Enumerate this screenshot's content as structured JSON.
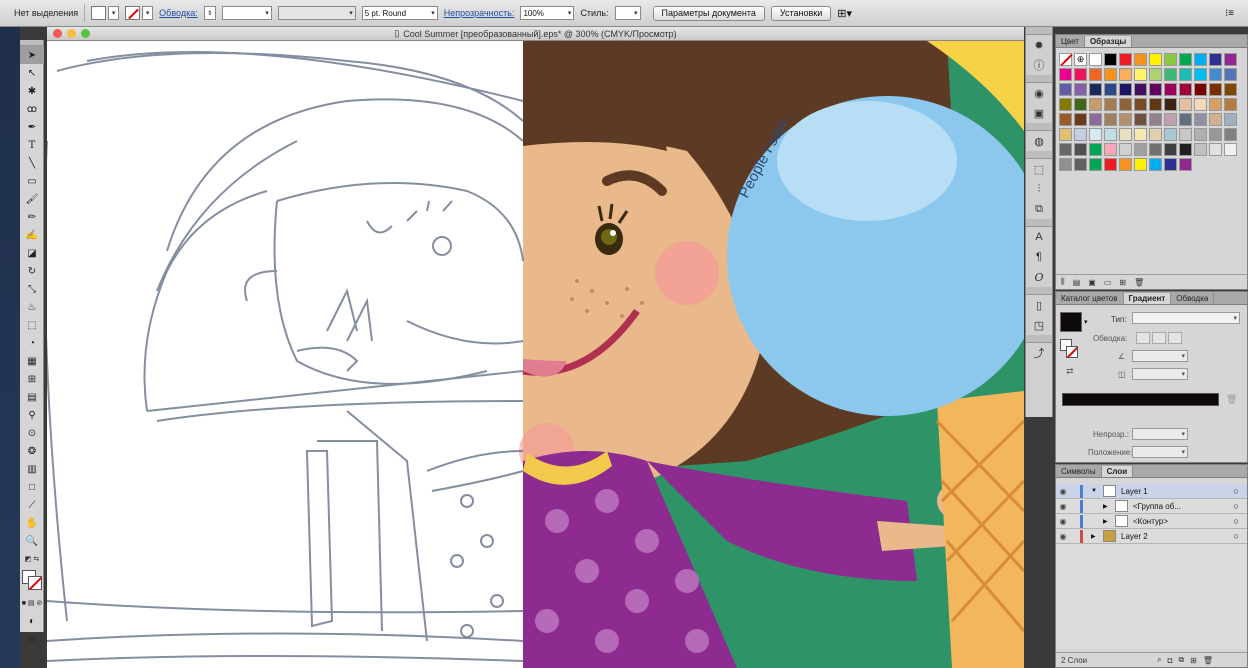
{
  "control_bar": {
    "selection": "Нет выделения",
    "stroke_label": "Обводка:",
    "brush": "5 pt. Round",
    "opacity_label": "Непрозрачность:",
    "opacity_value": "100%",
    "style_label": "Стиль:",
    "doc_settings": "Параметры документа",
    "preferences": "Установки"
  },
  "document": {
    "title": "Cool Summer [преобразованный].eps* @ 300% (CMYK/Просмотр)",
    "balloon_text": "People I saw..."
  },
  "swatches_panel": {
    "tabs": [
      "Цвет",
      "Образцы"
    ],
    "active_tab": "Образцы",
    "colors": [
      "#ffffff",
      "#000000",
      "#ed1c24",
      "#f7941d",
      "#fff200",
      "#8dc63f",
      "#00a651",
      "#00aeef",
      "#2e3192",
      "#92278f",
      "#ec008c",
      "#ed145b",
      "#f26522",
      "#f7941d",
      "#fbaf5d",
      "#fff568",
      "#acd373",
      "#3cb878",
      "#1cbbb4",
      "#00bff3",
      "#448ccb",
      "#5674b9",
      "#605ca8",
      "#855fa8",
      "#1a2a5c",
      "#2e4a8a",
      "#1b1464",
      "#440e62",
      "#630460",
      "#9e005d",
      "#9e0039",
      "#790000",
      "#7b2e00",
      "#7d4900",
      "#827b00",
      "#406618",
      "#c69c6d",
      "#a67c52",
      "#8c6239",
      "#754c24",
      "#603913",
      "#3c2415",
      "#e6c0a0",
      "#f0d8b8",
      "#d9a066",
      "#b57b45",
      "#9a5b2a",
      "#6b3a1a",
      "#8a6a9a",
      "#a08060",
      "#b09070",
      "#705040",
      "#908090",
      "#c0a0b0",
      "#607080",
      "#9090a0",
      "#d0b090",
      "#a0b0c0",
      "#e0c070",
      "#c0d0e0",
      "#d6e8f0",
      "#c2dde6",
      "#e8e0c0",
      "#f4e8b0",
      "#e0d0b0",
      "#a8c8d8",
      "#c8c8c8",
      "#b0b0b0",
      "#989898",
      "#808080",
      "#686868",
      "#505050",
      "#00a651",
      "#f7a8b8",
      "#d0d0d0",
      "#a0a0a0",
      "#707070",
      "#404040",
      "#202020",
      "#c0c0c0",
      "#e0e0e0",
      "#f0f0f0",
      "#909090",
      "#606060",
      "#00a651",
      "#ed1c24",
      "#f7941d",
      "#fff200",
      "#00aeef",
      "#2e3192",
      "#92278f"
    ]
  },
  "gradient_panel": {
    "tabs": [
      "Каталог цветов",
      "Градиент",
      "Обводка"
    ],
    "active_tab": "Градиент",
    "type_label": "Тип:",
    "stroke_label": "Обводка:",
    "opacity_label": "Непрозр.:",
    "position_label": "Положение:"
  },
  "layers_panel": {
    "tabs": [
      "Символы",
      "Слои"
    ],
    "active_tab": "Слои",
    "layers": [
      {
        "name": "Layer 1",
        "indent": 0,
        "expanded": true
      },
      {
        "name": "<Группа об...",
        "indent": 1,
        "expanded": false
      },
      {
        "name": "<Контур>",
        "indent": 1,
        "expanded": false
      },
      {
        "name": "Layer 2",
        "indent": 0,
        "expanded": false
      }
    ],
    "footer": "2 Слои"
  },
  "tools": [
    "selection-tool",
    "direct-selection-tool",
    "magic-wand-tool",
    "lasso-tool",
    "pen-tool",
    "type-tool",
    "line-tool",
    "rectangle-tool",
    "paintbrush-tool",
    "pencil-tool",
    "blob-brush-tool",
    "eraser-tool",
    "rotate-tool",
    "scale-tool",
    "warp-tool",
    "free-transform-tool",
    "shape-builder-tool",
    "perspective-grid-tool",
    "mesh-tool",
    "gradient-tool",
    "eyedropper-tool",
    "blend-tool",
    "symbol-sprayer-tool",
    "column-graph-tool",
    "artboard-tool",
    "slice-tool",
    "hand-tool",
    "zoom-tool"
  ]
}
